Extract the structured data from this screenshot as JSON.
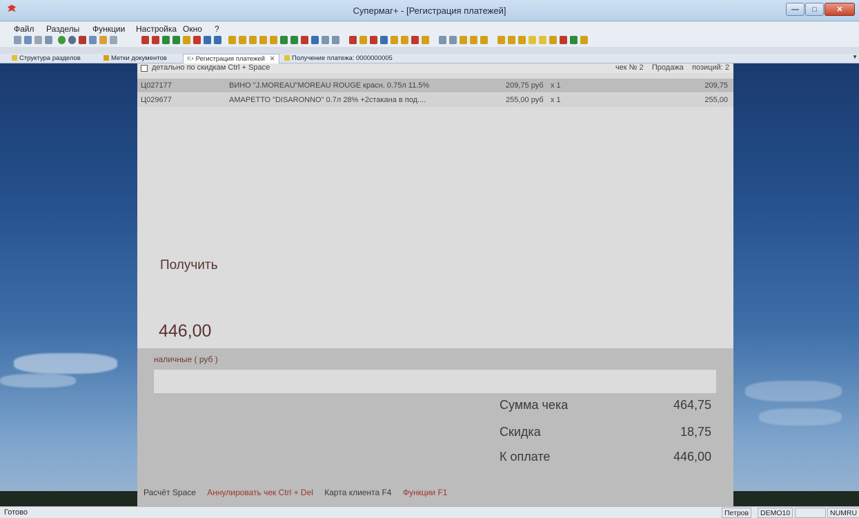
{
  "window": {
    "title": "Супермаг+  - [Регистрация платежей]"
  },
  "menu": [
    "Файл",
    "Разделы",
    "Функции",
    "Настройка",
    "Окно",
    "?"
  ],
  "tabs": [
    {
      "label": "Структура разделов",
      "active": false
    },
    {
      "label": "Метки документов",
      "active": false
    },
    {
      "label": "Регистрация платежей",
      "active": true
    },
    {
      "label": "Получение платежа: 0000000005",
      "active": false
    }
  ],
  "panel": {
    "header": {
      "checkbox_label": "детально по скидкам Ctrl + Space",
      "receipt_no": "чек № 2",
      "mode": "Продажа",
      "positions": "позиций: 2"
    },
    "items": [
      {
        "code": "Ц027177",
        "name": "ВИНО \"J.MOREAU\"MOREAU ROUGE красн. 0.75л 11.5%",
        "price": "209,75 руб",
        "qty": "x 1",
        "total": "209,75"
      },
      {
        "code": "Ц029677",
        "name": "АМАРЕТТО \"DISARONNO\"  0.7л 28% +2стакана в под....",
        "price": "255,00 руб",
        "qty": "x 1",
        "total": "255,00"
      }
    ],
    "receive_label": "Получить",
    "receive_amount": "446,00",
    "payment_label": "наличные ( руб )",
    "payment_value": "",
    "summary": {
      "sum_label": "Сумма чека",
      "sum_value": "464,75",
      "discount_label": "Скидка",
      "discount_value": "18,75",
      "topay_label": "К оплате",
      "topay_value": "446,00"
    },
    "hotkeys": {
      "calc": "Расчёт Space",
      "cancel": "Аннулировать чек Ctrl + Del",
      "card": "Карта клиента F4",
      "functions": "Функции F1"
    }
  },
  "status": {
    "left": "Готово",
    "user": "Петров",
    "db": "DEMO10",
    "keys": "NUMRU"
  },
  "colors": {
    "accent": "#5a3330",
    "hotkey_red": "#a0342a",
    "panel_bg": "#dcdcdc"
  }
}
